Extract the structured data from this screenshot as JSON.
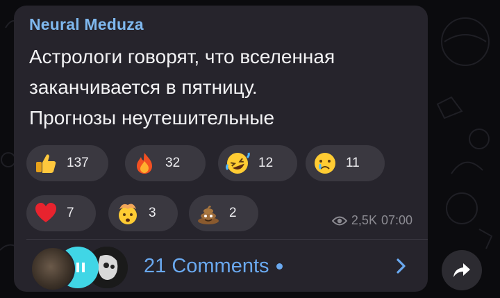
{
  "message": {
    "sender": "Neural Meduza",
    "text_lines": [
      "Астрологи говорят, что вселенная",
      "заканчивается в пятницу.",
      "Прогнозы неутешительные"
    ],
    "views": "2,5K",
    "time": "07:00"
  },
  "reactions": [
    {
      "emoji": "thumbs-up",
      "count": "137"
    },
    {
      "emoji": "fire",
      "count": "32"
    },
    {
      "emoji": "rolling-laughing",
      "count": "12"
    },
    {
      "emoji": "crying",
      "count": "11"
    },
    {
      "emoji": "red-heart",
      "count": "7"
    },
    {
      "emoji": "exploding-head",
      "count": "3"
    },
    {
      "emoji": "poop",
      "count": "2"
    }
  ],
  "comments": {
    "label": "21 Comments",
    "unread_dot": true
  },
  "icons": {
    "views": "eye-icon",
    "chevron": "chevron-right-icon",
    "share": "share-arrow-icon"
  },
  "colors": {
    "bubble": "#26242c",
    "sender": "#7fb8ee",
    "link": "#6aa9f0",
    "reaction_pill": "#3a3840"
  }
}
